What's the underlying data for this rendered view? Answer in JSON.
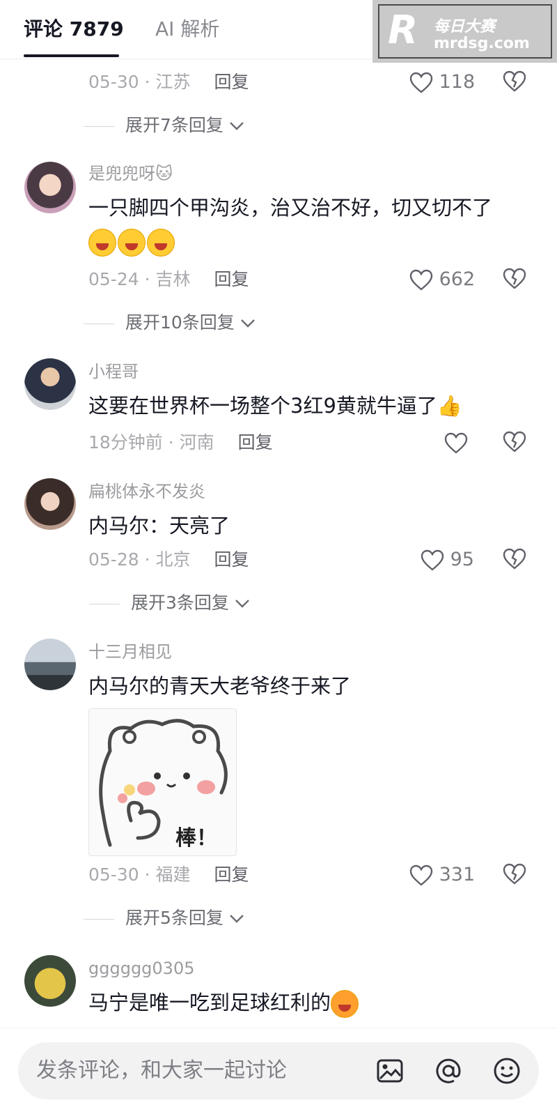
{
  "header": {
    "tab_comments": "评论 7879",
    "tab_ai": "AI 解析",
    "watermark_logo": "R",
    "watermark_name": "每日大赛",
    "watermark_url": "mrdsg.com"
  },
  "top_partial": {
    "meta_date": "05-30",
    "meta_region": "江苏",
    "reply": "回复",
    "likes": "118",
    "expand": "展开7条回复"
  },
  "comments": [
    {
      "username": "是兜兜呀🐱",
      "text": "一只脚四个甲沟炎，治又治不好，切又切不了",
      "emoji_line": "😂😂😂",
      "date": "05-24",
      "region": "吉林",
      "reply": "回复",
      "likes": "662",
      "expand": "展开10条回复"
    },
    {
      "username": "小程哥",
      "text": "这要在世界杯一场整个3红9黄就牛逼了👍",
      "date": "18分钟前",
      "region": "河南",
      "reply": "回复",
      "likes": ""
    },
    {
      "username": "扁桃体永不发炎",
      "text": "内马尔：天亮了",
      "date": "05-28",
      "region": "北京",
      "reply": "回复",
      "likes": "95",
      "expand": "展开3条回复"
    },
    {
      "username": "十三月相见",
      "text": "内马尔的青天大老爷终于来了",
      "sticker_text": "棒！",
      "date": "05-30",
      "region": "福建",
      "reply": "回复",
      "likes": "331",
      "expand": "展开5条回复"
    },
    {
      "username": "gggggg0305",
      "text": "马宁是唯一吃到足球红利的"
    }
  ],
  "bottom": {
    "placeholder": "发条评论，和大家一起讨论"
  },
  "icons": [
    "heart-icon",
    "broken-heart-icon",
    "chevron-down-icon",
    "image-icon",
    "at-icon",
    "smile-icon"
  ]
}
